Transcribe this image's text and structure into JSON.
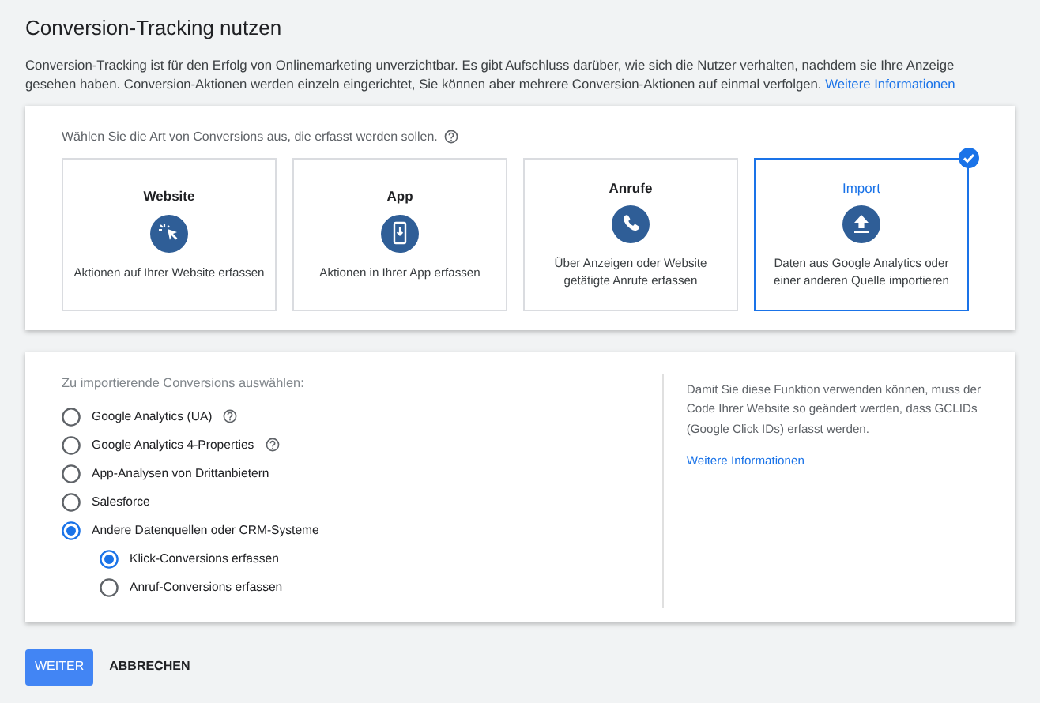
{
  "title": "Conversion-Tracking nutzen",
  "intro": {
    "text": "Conversion-Tracking ist für den Erfolg von Onlinemarketing unverzichtbar. Es gibt Aufschluss darüber, wie sich die Nutzer verhalten, nachdem sie Ihre Anzeige gesehen haben. Conversion-Aktionen werden einzeln eingerichtet, Sie können aber mehrere Conversion-Aktionen auf einmal verfolgen.",
    "link": "Weitere Informationen"
  },
  "type_picker": {
    "prompt": "Wählen Sie die Art von Conversions aus, die erfasst werden sollen.",
    "types": [
      {
        "kind": "website",
        "title": "Website",
        "description": "Aktionen auf Ihrer Website erfassen",
        "selected": false
      },
      {
        "kind": "app",
        "title": "App",
        "description": "Aktionen in Ihrer App erfassen",
        "selected": false
      },
      {
        "kind": "calls",
        "title": "Anrufe",
        "description": "Über Anzeigen oder Website getätigte Anrufe erfassen",
        "selected": false
      },
      {
        "kind": "import",
        "title": "Import",
        "description": "Daten aus Google Analytics oder einer anderen Quelle importieren",
        "selected": true
      }
    ]
  },
  "import_options": {
    "heading": "Zu importierende Conversions auswählen:",
    "options": [
      {
        "label": "Google Analytics (UA)",
        "help": true,
        "selected": false
      },
      {
        "label": "Google Analytics 4-Properties",
        "help": true,
        "selected": false
      },
      {
        "label": "App-Analysen von Drittanbietern",
        "help": false,
        "selected": false
      },
      {
        "label": "Salesforce",
        "help": false,
        "selected": false
      },
      {
        "label": "Andere Datenquellen oder CRM-Systeme",
        "help": false,
        "selected": true,
        "children": [
          {
            "label": "Klick-Conversions erfassen",
            "help": false,
            "selected": true
          },
          {
            "label": "Anruf-Conversions erfassen",
            "help": false,
            "selected": false
          }
        ]
      }
    ],
    "note": "Damit Sie diese Funktion verwenden können, muss der Code Ihrer Website so geändert werden, dass GCLIDs (Google Click IDs) erfasst werden.",
    "note_link": "Weitere Informationen"
  },
  "buttons": [
    {
      "label": "WEITER",
      "kind": "primary"
    },
    {
      "label": "ABBRECHEN",
      "kind": "text"
    }
  ]
}
